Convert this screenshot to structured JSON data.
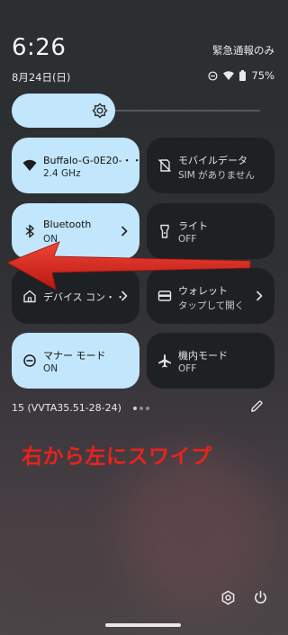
{
  "status": {
    "time": "6:26",
    "date": "8月24日(日)",
    "emergency_label": "緊急通報のみ",
    "battery": "75%"
  },
  "brightness": {
    "level_fraction": 0.4,
    "icon": "brightness-icon"
  },
  "tiles": [
    {
      "title": "Buffalo-G-0E20-・・",
      "subtitle": "2.4 GHz",
      "state": "on",
      "icon": "wifi-icon",
      "chevron": false
    },
    {
      "title": "モバイルデータ",
      "subtitle": "SIM がありません",
      "state": "off",
      "icon": "no-sim-icon",
      "chevron": false
    },
    {
      "title": "Bluetooth",
      "subtitle": "ON",
      "state": "on",
      "icon": "bluetooth-icon",
      "chevron": true
    },
    {
      "title": "ライト",
      "subtitle": "OFF",
      "state": "off",
      "icon": "flashlight-icon",
      "chevron": false
    },
    {
      "title": "デバイス コン・・",
      "subtitle": "",
      "state": "off",
      "icon": "home-icon",
      "chevron": true
    },
    {
      "title": "ウォレット",
      "subtitle": "タップして開く",
      "state": "off",
      "icon": "wallet-icon",
      "chevron": true
    },
    {
      "title": "マナー モード",
      "subtitle": "ON",
      "state": "on",
      "icon": "do-not-disturb-icon",
      "chevron": false
    },
    {
      "title": "機内モード",
      "subtitle": "OFF",
      "state": "off",
      "icon": "airplane-icon",
      "chevron": false
    }
  ],
  "footer": {
    "build_number": "15 (VVTA35.51-28-24)",
    "page_indicator": {
      "pages": 3,
      "current": 1
    }
  },
  "annotation": {
    "text": "右から左にスワイプ",
    "color": "#e8231c"
  },
  "colors": {
    "tile_on": "#c2e6fb",
    "tile_off": "#1e2124",
    "arrow": "#d9261c"
  }
}
